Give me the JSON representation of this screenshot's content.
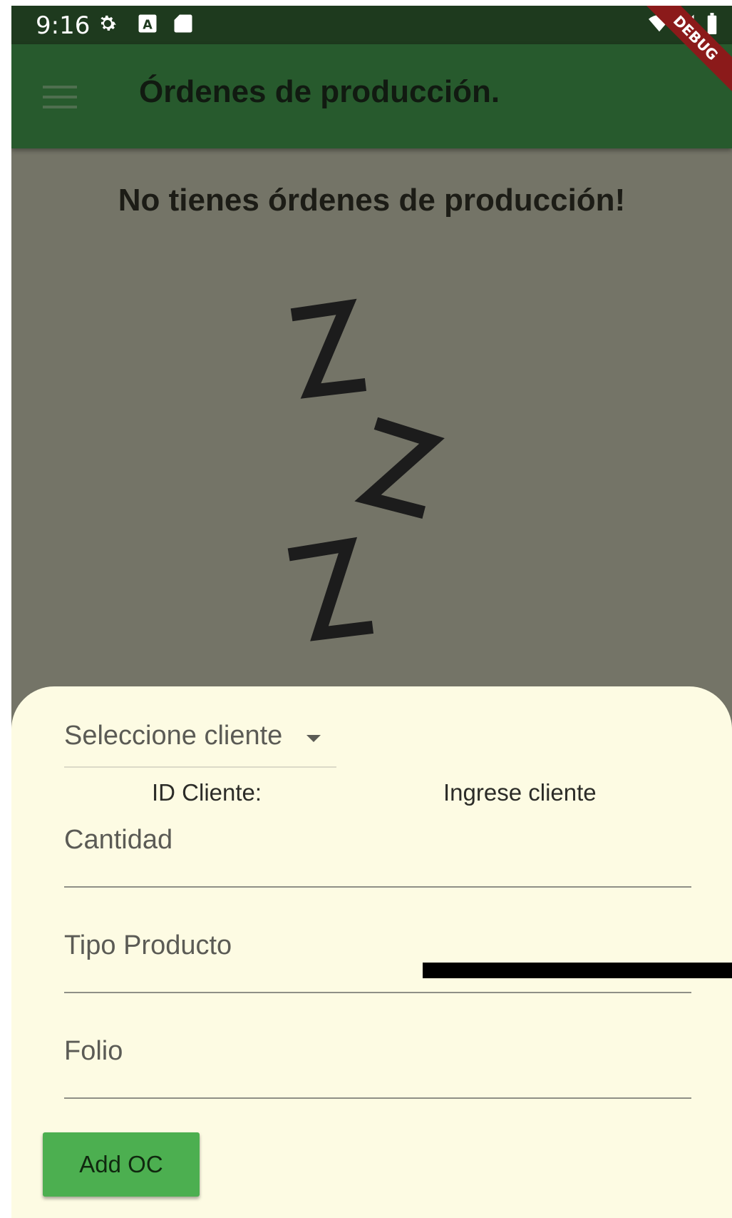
{
  "status_bar": {
    "time": "9:16",
    "icons": [
      "gear-icon",
      "keyboard-a-icon",
      "sd-card-icon",
      "wifi-icon",
      "signal-icon",
      "battery-icon"
    ],
    "debug_label": "DEBUG"
  },
  "app_bar": {
    "title": "Órdenes de producción.",
    "menu_icon": "hamburger-menu-icon",
    "color": "#275a2d"
  },
  "empty_state": {
    "message": "No tienes órdenes de producción!",
    "illustration": "zzz-sleep-icon"
  },
  "form": {
    "client_dropdown": {
      "selected": "Seleccione cliente"
    },
    "id_cliente_label": "ID Cliente:",
    "id_cliente_value": "Ingrese cliente",
    "fields": [
      {
        "placeholder": "Cantidad",
        "value": ""
      },
      {
        "placeholder": "Tipo Producto",
        "value": ""
      },
      {
        "placeholder": "Folio",
        "value": ""
      }
    ],
    "submit_label": "Add OC",
    "submit_color": "#4caf50"
  },
  "colors": {
    "status_bar": "#1e3a1e",
    "background": "#747467",
    "sheet": "#fdfbe3"
  }
}
